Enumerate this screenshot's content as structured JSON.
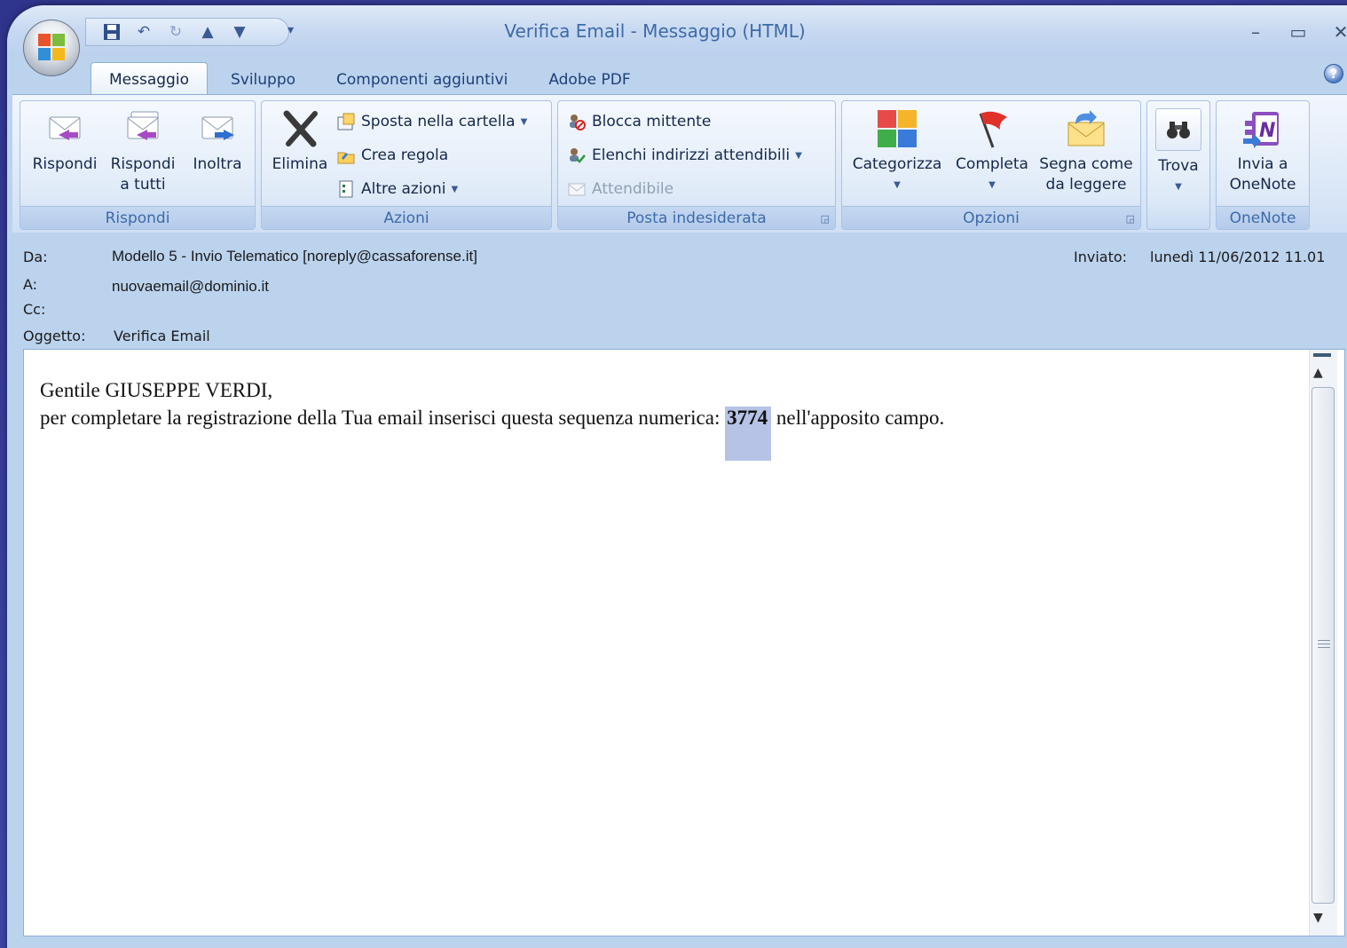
{
  "window": {
    "title": "Verifica Email - Messaggio (HTML)",
    "controls": {
      "minimize": "–",
      "maximize": "▭",
      "close": "✕"
    }
  },
  "qat": {
    "more": "▾"
  },
  "tabs": [
    {
      "label": "Messaggio",
      "active": true
    },
    {
      "label": "Sviluppo"
    },
    {
      "label": "Componenti aggiuntivi"
    },
    {
      "label": "Adobe PDF"
    }
  ],
  "help": "?",
  "ribbon": {
    "rispondi": {
      "label": "Rispondi",
      "reply": "Rispondi",
      "reply_all_1": "Rispondi",
      "reply_all_2": "a tutti",
      "forward": "Inoltra"
    },
    "azioni": {
      "label": "Azioni",
      "delete": "Elimina",
      "move": "Sposta nella cartella",
      "rule": "Crea regola",
      "other": "Altre azioni"
    },
    "junk": {
      "label": "Posta indesiderata",
      "block": "Blocca mittente",
      "safe_lists": "Elenchi indirizzi attendibili",
      "safe": "Attendibile"
    },
    "opzioni": {
      "label": "Opzioni",
      "categorize": "Categorizza",
      "followup": "Completa",
      "mark_1": "Segna come",
      "mark_2": "da leggere"
    },
    "trova": {
      "find": "Trova"
    },
    "onenote": {
      "label": "OneNote",
      "send_1": "Invia a",
      "send_2": "OneNote"
    }
  },
  "header": {
    "from_label": "Da:",
    "from": "Modello 5 - Invio Telematico [noreply@cassaforense.it]",
    "to_label": "A:",
    "to": "nuovaemail@dominio.it",
    "cc_label": "Cc:",
    "subject_label": "Oggetto:",
    "subject": "Verifica Email",
    "sent_label": "Inviato:",
    "sent": "lunedì 11/06/2012 11.01"
  },
  "body": {
    "greeting": "Gentile GIUSEPPE VERDI,",
    "line_start": "per completare la registrazione della Tua email inserisci questa sequenza numerica: ",
    "code": "3774",
    "line_end": " nell'apposito campo."
  },
  "colors": {
    "accent": "#3e6aa8",
    "highlight": "#b6c3e6"
  }
}
